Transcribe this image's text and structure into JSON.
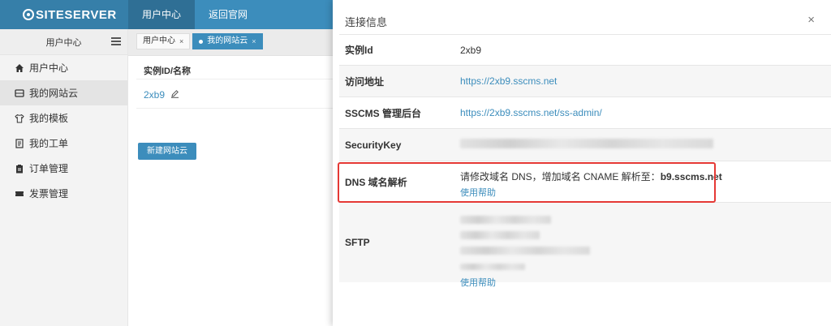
{
  "app": {
    "logo_text": "SITESERVER"
  },
  "topnav": [
    {
      "label": "用户中心",
      "active": true
    },
    {
      "label": "返回官网",
      "active": false
    }
  ],
  "sidebar": {
    "header": "用户中心",
    "items": [
      {
        "label": "用户中心",
        "icon": "home-icon",
        "active": false
      },
      {
        "label": "我的网站云",
        "icon": "server-icon",
        "active": true
      },
      {
        "label": "我的模板",
        "icon": "shirt-icon",
        "active": false
      },
      {
        "label": "我的工单",
        "icon": "document-icon",
        "active": false
      },
      {
        "label": "订单管理",
        "icon": "clipboard-icon",
        "active": false
      },
      {
        "label": "发票管理",
        "icon": "ticket-icon",
        "active": false
      }
    ]
  },
  "tabs": [
    {
      "label": "用户中心",
      "close": "×",
      "active": false
    },
    {
      "label": "我的网站云",
      "close": "×",
      "active": true
    }
  ],
  "table": {
    "header": "实例ID/名称",
    "rows": [
      {
        "id": "2xb9"
      }
    ]
  },
  "buttons": {
    "new_cloud": "新建网站云"
  },
  "modal": {
    "title": "连接信息",
    "close": "×",
    "rows": {
      "instance_id": {
        "label": "实例Id",
        "value": "2xb9"
      },
      "url": {
        "label": "访问地址",
        "value": "https://2xb9.sscms.net"
      },
      "admin": {
        "label": "SSCMS 管理后台",
        "value": "https://2xb9.sscms.net/ss-admin/"
      },
      "security_key": {
        "label": "SecurityKey"
      },
      "dns": {
        "label": "DNS 域名解析",
        "text": "请修改域名 DNS，增加域名 CNAME 解析至：",
        "target": "b9.sscms.net",
        "help": "使用帮助"
      },
      "sftp": {
        "label": "SFTP",
        "help": "使用帮助"
      }
    }
  },
  "colors": {
    "primary": "#3c8dbc",
    "highlight": "#e53935"
  }
}
